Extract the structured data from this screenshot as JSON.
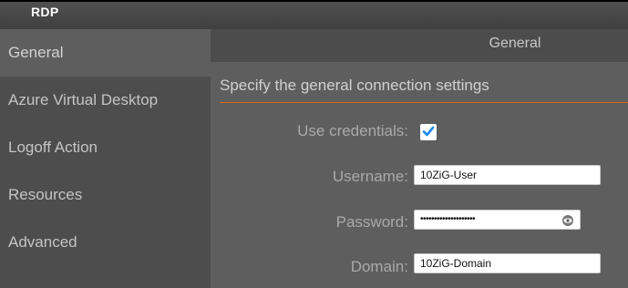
{
  "window": {
    "title": "RDP"
  },
  "sidebar": {
    "items": [
      {
        "label": "General",
        "active": true
      },
      {
        "label": "Azure Virtual Desktop",
        "active": false
      },
      {
        "label": "Logoff Action",
        "active": false
      },
      {
        "label": "Resources",
        "active": false
      },
      {
        "label": "Advanced",
        "active": false
      }
    ]
  },
  "main": {
    "header_title": "General",
    "section_title": "Specify the general connection settings",
    "use_credentials": {
      "label": "Use credentials:",
      "checked": true
    },
    "username": {
      "label": "Username:",
      "value": "10ZiG-User"
    },
    "password": {
      "label": "Password:",
      "value": "••••••••••••••••••••",
      "reveal_icon": "eye-icon"
    },
    "domain": {
      "label": "Domain:",
      "value": "10ZiG-Domain"
    }
  },
  "colors": {
    "accent_divider": "#d2691e",
    "checkbox_check": "#1e88e5"
  }
}
